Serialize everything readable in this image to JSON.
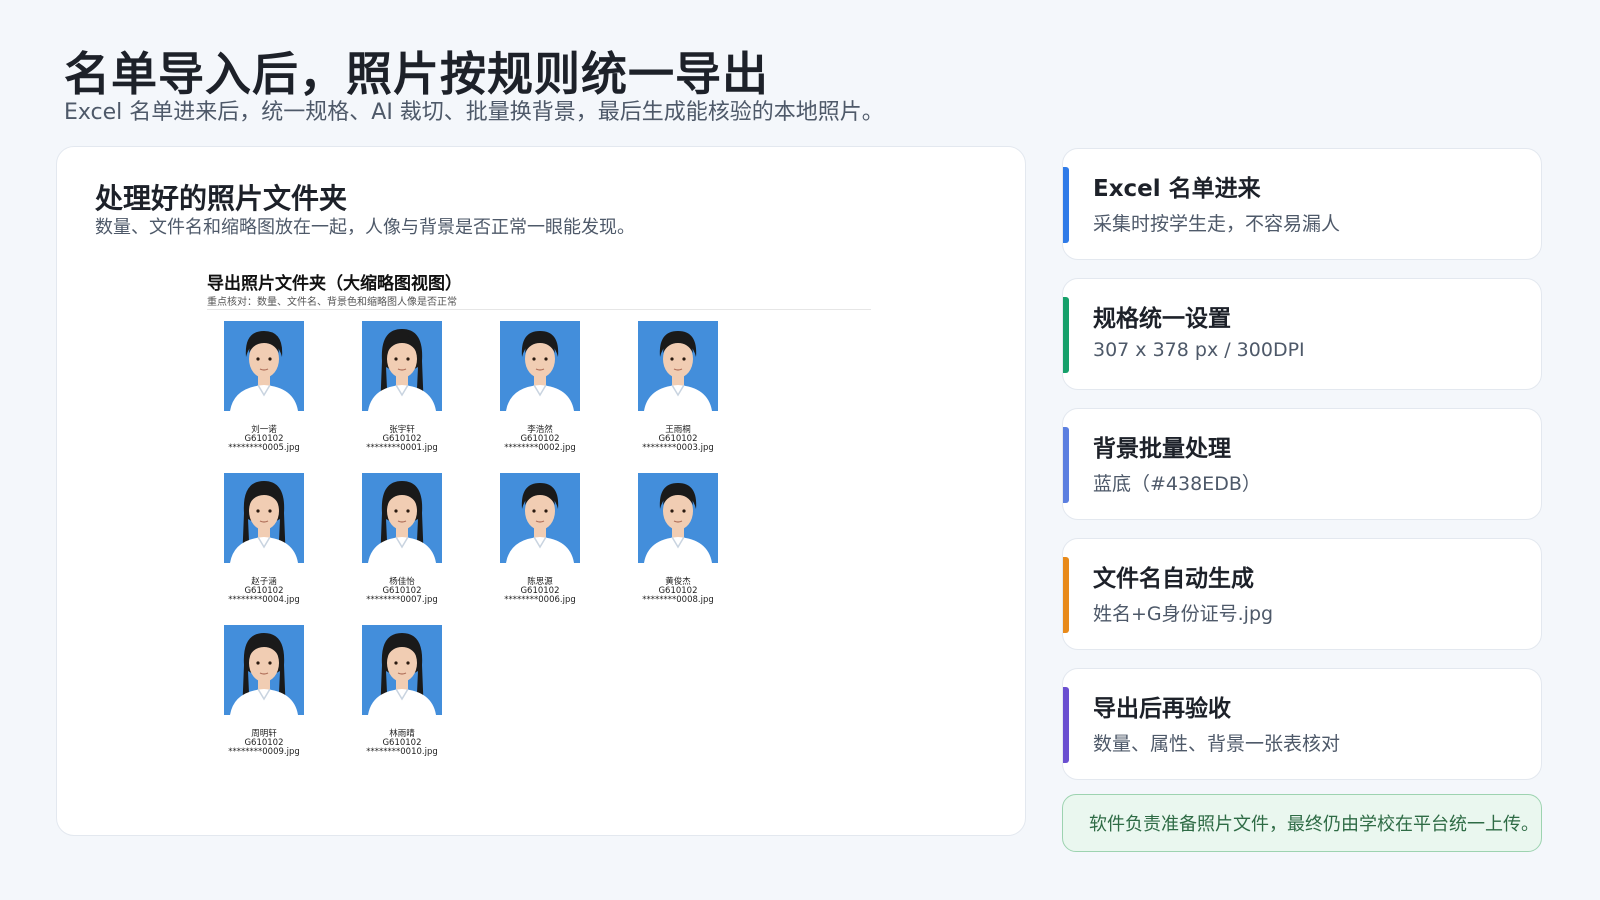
{
  "header": {
    "title": "名单导入后，照片按规则统一导出",
    "subtitle": "Excel 名单进来后，统一规格、AI 裁切、批量换背景，最后生成能核验的本地照片。"
  },
  "main_card": {
    "title": "处理好的照片文件夹",
    "subtitle": "数量、文件名和缩略图放在一起，人像与背景是否正常一眼能发现。",
    "explorer": {
      "title": "导出照片文件夹（大缩略图视图）",
      "note": "重点核对：数量、文件名、背景色和缩略图人像是否正常",
      "photos": [
        {
          "name": "刘一诺",
          "code": "G610102",
          "file": "********0005.jpg",
          "gender": "m"
        },
        {
          "name": "张宇轩",
          "code": "G610102",
          "file": "********0001.jpg",
          "gender": "f"
        },
        {
          "name": "李浩然",
          "code": "G610102",
          "file": "********0002.jpg",
          "gender": "m"
        },
        {
          "name": "王雨桐",
          "code": "G610102",
          "file": "********0003.jpg",
          "gender": "m"
        },
        {
          "name": "赵子涵",
          "code": "G610102",
          "file": "********0004.jpg",
          "gender": "f"
        },
        {
          "name": "杨佳怡",
          "code": "G610102",
          "file": "********0007.jpg",
          "gender": "f"
        },
        {
          "name": "陈思源",
          "code": "G610102",
          "file": "********0006.jpg",
          "gender": "m"
        },
        {
          "name": "黄俊杰",
          "code": "G610102",
          "file": "********0008.jpg",
          "gender": "m"
        },
        {
          "name": "周明轩",
          "code": "G610102",
          "file": "********0009.jpg",
          "gender": "f"
        },
        {
          "name": "林雨晴",
          "code": "G610102",
          "file": "********0010.jpg",
          "gender": "f"
        }
      ]
    }
  },
  "steps": [
    {
      "title": "Excel 名单进来",
      "desc": "采集时按学生走，不容易漏人",
      "color": "#2f7be8"
    },
    {
      "title": "规格统一设置",
      "desc": "307 x 378 px / 300DPI",
      "color": "#16a06a"
    },
    {
      "title": "背景批量处理",
      "desc": "蓝底（#438EDB）",
      "color": "#5b7fe0"
    },
    {
      "title": "文件名自动生成",
      "desc": "姓名+G身份证号.jpg",
      "color": "#e88a1a"
    },
    {
      "title": "导出后再验收",
      "desc": "数量、属性、背景一张表核对",
      "color": "#6a4fd0"
    }
  ],
  "footer_note": "软件负责准备照片文件，最终仍由学校在平台统一上传。",
  "colors": {
    "photo_background": "#438EDB",
    "note_background": "#eaf7ef",
    "note_text": "#2e6b45"
  }
}
